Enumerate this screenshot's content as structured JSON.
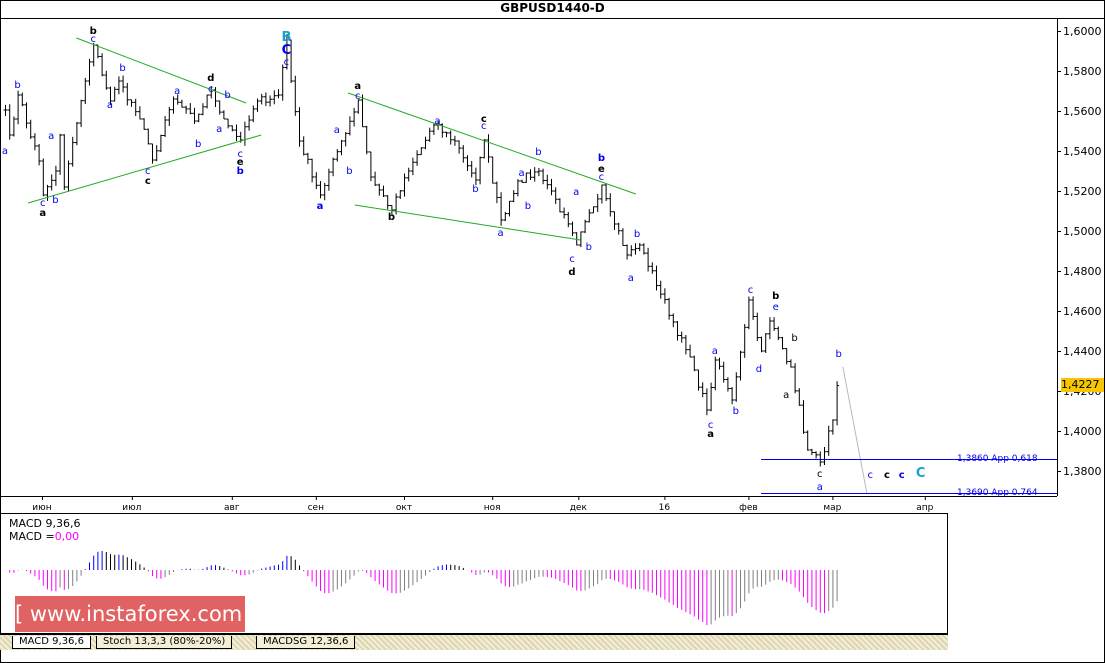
{
  "title": "GBPUSD1440-D",
  "current_price_label": "1,4227",
  "macd_legend": {
    "name": "MACD 9,36,6",
    "value_label": "MACD =",
    "value": "0,00"
  },
  "tabs": [
    "MACD 9,36,6",
    "Stoch 13,3,3 (80%-20%)",
    "MACDSG 12,36,6"
  ],
  "watermark": "[ www.instaforex.com ]",
  "levels": [
    {
      "price": 1.386,
      "label": "1,3860 App 0,618",
      "color": "#0000ee"
    },
    {
      "price": 1.369,
      "label": "1,3690 App 0.764",
      "color": "#0000ee"
    }
  ],
  "colors": {
    "bars": "#000000",
    "trendline": "#22aa22",
    "wave_blue": "#0000ee",
    "wave_black": "#000000",
    "wave_cyan": "#1aa0d0",
    "macd_pos_up": "#0000ff",
    "macd_pos_down": "#000000",
    "macd_neg_down": "#ff00ff",
    "macd_neg_up": "#808080",
    "price_box": "#f7c600"
  },
  "chart_data": {
    "type": "ohlc",
    "symbol": "GBPUSD",
    "timeframe": "D1",
    "ylim": [
      1.367,
      1.6055
    ],
    "yticks": [
      "1,6000",
      "1,5800",
      "1,5600",
      "1,5400",
      "1,5200",
      "1,5000",
      "1,4800",
      "1,4600",
      "1,4400",
      "1,4200",
      "1,4000",
      "1,3800"
    ],
    "ytick_values": [
      1.6,
      1.58,
      1.56,
      1.54,
      1.52,
      1.5,
      1.48,
      1.46,
      1.44,
      1.42,
      1.4,
      1.38
    ],
    "xlim_days": [
      -1,
      250
    ],
    "xticks": [
      {
        "label": "июн",
        "day": 8.8
      },
      {
        "label": "июл",
        "day": 30.2
      },
      {
        "label": "авг",
        "day": 54
      },
      {
        "label": "сен",
        "day": 74
      },
      {
        "label": "окт",
        "day": 95
      },
      {
        "label": "ноя",
        "day": 116
      },
      {
        "label": "дек",
        "day": 136.5
      },
      {
        "label": "16",
        "day": 157
      },
      {
        "label": "фев",
        "day": 177
      },
      {
        "label": "мар",
        "day": 197
      },
      {
        "label": "апр",
        "day": 219
      }
    ],
    "close_waypoints": [
      [
        0,
        1.5605
      ],
      [
        1,
        1.548
      ],
      [
        3,
        1.568
      ],
      [
        8,
        1.535
      ],
      [
        9,
        1.518
      ],
      [
        12,
        1.53
      ],
      [
        13,
        1.548
      ],
      [
        14,
        1.522
      ],
      [
        19,
        1.575
      ],
      [
        21,
        1.593
      ],
      [
        25,
        1.565
      ],
      [
        27,
        1.575
      ],
      [
        32,
        1.556
      ],
      [
        35,
        1.5355
      ],
      [
        40,
        1.566
      ],
      [
        45,
        1.555
      ],
      [
        49,
        1.5705
      ],
      [
        52,
        1.556
      ],
      [
        56,
        1.5455
      ],
      [
        60,
        1.565
      ],
      [
        65,
        1.568
      ],
      [
        67,
        1.5955
      ],
      [
        68,
        1.575
      ],
      [
        70,
        1.545
      ],
      [
        75,
        1.518
      ],
      [
        80,
        1.545
      ],
      [
        84,
        1.5655
      ],
      [
        87,
        1.527
      ],
      [
        92,
        1.5105
      ],
      [
        96,
        1.53
      ],
      [
        102,
        1.553
      ],
      [
        107,
        1.545
      ],
      [
        112,
        1.5255
      ],
      [
        114,
        1.5455
      ],
      [
        118,
        1.5055
      ],
      [
        122,
        1.525
      ],
      [
        127,
        1.53
      ],
      [
        130,
        1.52
      ],
      [
        136,
        1.493
      ],
      [
        142,
        1.523
      ],
      [
        148,
        1.488
      ],
      [
        151,
        1.493
      ],
      [
        164,
        1.4305
      ],
      [
        167,
        1.4105
      ],
      [
        169,
        1.4355
      ],
      [
        173,
        1.4155
      ],
      [
        177,
        1.4655
      ],
      [
        180,
        1.44
      ],
      [
        182,
        1.455
      ],
      [
        187,
        1.432
      ],
      [
        191,
        1.3905
      ],
      [
        194,
        1.3845
      ],
      [
        197,
        1.4055
      ],
      [
        198,
        1.4227
      ]
    ],
    "trendlines": [
      {
        "from": [
          5.5,
          1.514
        ],
        "to": [
          61,
          1.548
        ]
      },
      {
        "from": [
          17,
          1.5965
        ],
        "to": [
          57.4,
          1.564
        ]
      },
      {
        "from": [
          81.7,
          1.569
        ],
        "to": [
          150.2,
          1.5185
        ]
      },
      {
        "from": [
          83.3,
          1.513
        ],
        "to": [
          137,
          1.4955
        ]
      }
    ],
    "projection": {
      "from": [
        199.5,
        1.432
      ],
      "to": [
        205.2,
        1.369
      ]
    },
    "level_start_day": 180,
    "wave_labels": [
      {
        "t": "a",
        "d": 0,
        "p": 1.5405,
        "c": "b"
      },
      {
        "t": "b",
        "d": 3,
        "p": 1.5735,
        "c": "b"
      },
      {
        "t": "c",
        "d": 9,
        "p": 1.5145,
        "c": "b"
      },
      {
        "t": "a",
        "d": 9,
        "p": 1.5095,
        "c": "k",
        "bold": 1
      },
      {
        "t": "b",
        "d": 12,
        "p": 1.516,
        "c": "b"
      },
      {
        "t": "a",
        "d": 11,
        "p": 1.548,
        "c": "b"
      },
      {
        "t": "c",
        "d": 21,
        "p": 1.5965,
        "c": "b"
      },
      {
        "t": "b",
        "d": 21,
        "p": 1.6005,
        "c": "k",
        "bold": 1
      },
      {
        "t": "a",
        "d": 25,
        "p": 1.5635,
        "c": "b"
      },
      {
        "t": "b",
        "d": 28,
        "p": 1.582,
        "c": "b"
      },
      {
        "t": "c",
        "d": 34,
        "p": 1.5305,
        "c": "b"
      },
      {
        "t": "c",
        "d": 34,
        "p": 1.5255,
        "c": "k",
        "bold": 1
      },
      {
        "t": "a",
        "d": 41,
        "p": 1.5705,
        "c": "b"
      },
      {
        "t": "b",
        "d": 46,
        "p": 1.544,
        "c": "b"
      },
      {
        "t": "d",
        "d": 49,
        "p": 1.577,
        "c": "k",
        "bold": 1
      },
      {
        "t": "c",
        "d": 49,
        "p": 1.5715,
        "c": "b"
      },
      {
        "t": "a",
        "d": 51,
        "p": 1.5515,
        "c": "b"
      },
      {
        "t": "b",
        "d": 53,
        "p": 1.5685,
        "c": "b"
      },
      {
        "t": "c",
        "d": 56,
        "p": 1.539,
        "c": "b"
      },
      {
        "t": "e",
        "d": 56,
        "p": 1.535,
        "c": "k",
        "bold": 1
      },
      {
        "t": "b",
        "d": 56,
        "p": 1.5305,
        "c": "b",
        "bold": 1
      },
      {
        "t": "B",
        "d": 67,
        "p": 1.597,
        "c": "c",
        "bold": 1,
        "big": 1
      },
      {
        "t": "C",
        "d": 67,
        "p": 1.5905,
        "c": "b",
        "bold": 1,
        "big": 1
      },
      {
        "t": "c",
        "d": 67,
        "p": 1.585,
        "c": "b"
      },
      {
        "t": "a",
        "d": 75,
        "p": 1.513,
        "c": "b",
        "bold": 1
      },
      {
        "t": "a",
        "d": 79,
        "p": 1.551,
        "c": "b"
      },
      {
        "t": "b",
        "d": 82,
        "p": 1.5305,
        "c": "b"
      },
      {
        "t": "a",
        "d": 84,
        "p": 1.573,
        "c": "k",
        "bold": 1
      },
      {
        "t": "c",
        "d": 84,
        "p": 1.568,
        "c": "b"
      },
      {
        "t": "b",
        "d": 92,
        "p": 1.5075,
        "c": "k",
        "bold": 1
      },
      {
        "t": "a",
        "d": 103,
        "p": 1.5555,
        "c": "b"
      },
      {
        "t": "c",
        "d": 114,
        "p": 1.5565,
        "c": "k",
        "bold": 1
      },
      {
        "t": "c",
        "d": 114,
        "p": 1.553,
        "c": "b"
      },
      {
        "t": "b",
        "d": 112,
        "p": 1.5215,
        "c": "b"
      },
      {
        "t": "a",
        "d": 118,
        "p": 1.4995,
        "c": "b"
      },
      {
        "t": "a",
        "d": 123,
        "p": 1.5295,
        "c": "b"
      },
      {
        "t": "b",
        "d": 124.5,
        "p": 1.513,
        "c": "b"
      },
      {
        "t": "b",
        "d": 127,
        "p": 1.54,
        "c": "b"
      },
      {
        "t": "c",
        "d": 135,
        "p": 1.4865,
        "c": "b"
      },
      {
        "t": "d",
        "d": 135,
        "p": 1.48,
        "c": "k",
        "bold": 1
      },
      {
        "t": "b",
        "d": 139,
        "p": 1.4925,
        "c": "b"
      },
      {
        "t": "a",
        "d": 136,
        "p": 1.52,
        "c": "b"
      },
      {
        "t": "b",
        "d": 142,
        "p": 1.537,
        "c": "b",
        "bold": 1
      },
      {
        "t": "e",
        "d": 142,
        "p": 1.5315,
        "c": "k",
        "bold": 1
      },
      {
        "t": "c",
        "d": 142,
        "p": 1.5275,
        "c": "b"
      },
      {
        "t": "a",
        "d": 149,
        "p": 1.477,
        "c": "b"
      },
      {
        "t": "b",
        "d": 150.5,
        "p": 1.499,
        "c": "b"
      },
      {
        "t": "c",
        "d": 168,
        "p": 1.4035,
        "c": "b"
      },
      {
        "t": "a",
        "d": 168,
        "p": 1.399,
        "c": "k",
        "bold": 1
      },
      {
        "t": "a",
        "d": 169,
        "p": 1.4405,
        "c": "b"
      },
      {
        "t": "b",
        "d": 174,
        "p": 1.4105,
        "c": "b"
      },
      {
        "t": "c",
        "d": 177.5,
        "p": 1.471,
        "c": "b"
      },
      {
        "t": "d",
        "d": 179.5,
        "p": 1.4315,
        "c": "b"
      },
      {
        "t": "b",
        "d": 183.5,
        "p": 1.468,
        "c": "k",
        "bold": 1
      },
      {
        "t": "e",
        "d": 183.5,
        "p": 1.4625,
        "c": "b"
      },
      {
        "t": "b",
        "d": 188,
        "p": 1.447,
        "c": "k"
      },
      {
        "t": "a",
        "d": 186,
        "p": 1.4185,
        "c": "k"
      },
      {
        "t": "c",
        "d": 194,
        "p": 1.379,
        "c": "k"
      },
      {
        "t": "a",
        "d": 194,
        "p": 1.3725,
        "c": "b"
      },
      {
        "t": "b",
        "d": 198.5,
        "p": 1.439,
        "c": "b"
      },
      {
        "t": "c",
        "d": 206,
        "p": 1.3785,
        "c": "b"
      },
      {
        "t": "c",
        "d": 210,
        "p": 1.3785,
        "c": "k",
        "bold": 1
      },
      {
        "t": "c",
        "d": 213.5,
        "p": 1.3785,
        "c": "b",
        "bold": 1
      },
      {
        "t": "C",
        "d": 218,
        "p": 1.379,
        "c": "c",
        "bold": 1,
        "big": 1
      }
    ]
  }
}
